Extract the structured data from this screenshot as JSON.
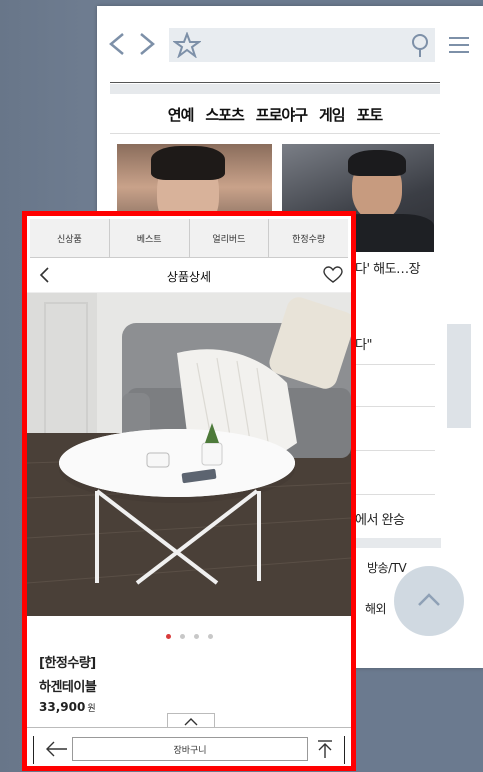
{
  "browser": {
    "categories": [
      "연예",
      "스포츠",
      "프로야구",
      "게임",
      "포토"
    ],
    "news": {
      "line1": "다' 해도…장",
      "line2": "다\"",
      "line3": "에서 완승",
      "line4": "방송/TV",
      "line5": "해외"
    }
  },
  "app": {
    "tabs": [
      "신상품",
      "베스트",
      "얼리버드",
      "한정수량"
    ],
    "header_title": "상품상세",
    "product": {
      "badge": "[한정수량]",
      "name": "하겐테이블",
      "price": "33,900",
      "currency": "원"
    },
    "image_dots": {
      "count": 4,
      "active_index": 0
    },
    "bottom": {
      "cart_label": "장바구니"
    }
  },
  "colors": {
    "highlight_border": "#ff0000",
    "icon_blue": "#7d90a8",
    "active_dot": "#d83b3b"
  }
}
